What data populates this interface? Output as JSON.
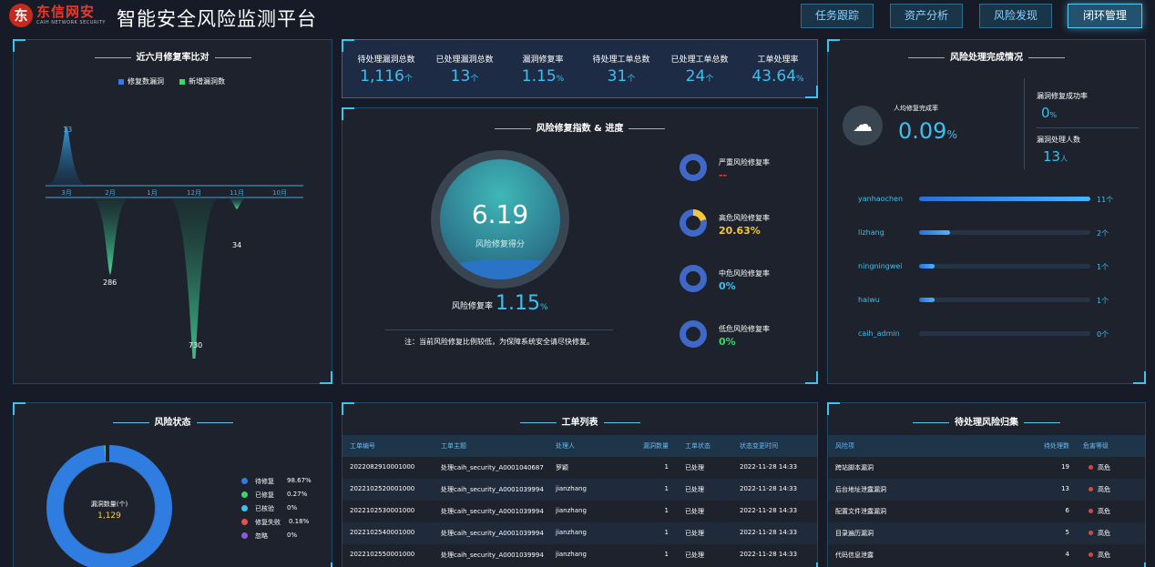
{
  "brand": {
    "logo_char": "东",
    "name": "东信网安",
    "sub": "CAIH NETWORK SECURITY"
  },
  "app_title": "智能安全风险监测平台",
  "nav": [
    "任务跟踪",
    "资产分析",
    "风险发现",
    "闭环管理"
  ],
  "nav_active": "闭环管理",
  "repair_compare": {
    "title": "近六月修复率比对",
    "legend": [
      "修复数漏洞",
      "新增漏洞数"
    ],
    "months": [
      "3月",
      "2月",
      "1月",
      "12月",
      "11月",
      "10月"
    ],
    "chart_data": {
      "type": "area",
      "categories": [
        "3月",
        "2月",
        "1月",
        "12月",
        "11月",
        "10月"
      ],
      "series": [
        {
          "name": "修复数漏洞",
          "values": [
            13,
            0,
            0,
            0,
            0,
            0
          ]
        },
        {
          "name": "新增漏洞数",
          "values": [
            0,
            286,
            0,
            730,
            34,
            0
          ]
        }
      ]
    },
    "labels": {
      "up": "13",
      "down1": "286",
      "down2": "730",
      "down3": "34"
    }
  },
  "stats": [
    {
      "label": "待处理漏洞总数",
      "value": "1,116",
      "unit": "个"
    },
    {
      "label": "已处理漏洞总数",
      "value": "13",
      "unit": "个"
    },
    {
      "label": "漏洞修复率",
      "value": "1.15",
      "unit": "%"
    },
    {
      "label": "待处理工单总数",
      "value": "31",
      "unit": "个"
    },
    {
      "label": "已处理工单总数",
      "value": "24",
      "unit": "个"
    },
    {
      "label": "工单处理率",
      "value": "43.64",
      "unit": "%"
    }
  ],
  "risk_index": {
    "title": "风险修复指数 & 进度",
    "score": "6.19",
    "score_label": "风险修复得分",
    "rate_label": "风险修复率",
    "rate_value": "1.15",
    "rate_unit": "%",
    "note": "注：当前风险修复比例较低，为保障系统安全请尽快修复。",
    "levels": [
      {
        "label": "严重风险修复率",
        "value": "--",
        "color": "#e8413a",
        "fraction": 0
      },
      {
        "label": "高危风险修复率",
        "value": "20.63%",
        "color": "#f4c83a",
        "fraction": 0.2063
      },
      {
        "label": "中危风险修复率",
        "value": "0%",
        "color": "#3cc0f0",
        "fraction": 0
      },
      {
        "label": "低危风险修复率",
        "value": "0%",
        "color": "#3ad86a",
        "fraction": 0
      }
    ]
  },
  "completion": {
    "title": "风险处理完成情况",
    "avg_label": "人均修复完成率",
    "avg_value": "0.09",
    "avg_unit": "%",
    "success_label": "漏洞修复成功率",
    "success_value": "0",
    "success_unit": "%",
    "handlers_label": "漏洞处理人数",
    "handlers_value": "13",
    "handlers_unit": "人",
    "people": [
      {
        "name": "yanhaochen",
        "count": "11个",
        "fraction": 1.0
      },
      {
        "name": "lizhang",
        "count": "2个",
        "fraction": 0.18
      },
      {
        "name": "ningningwei",
        "count": "1个",
        "fraction": 0.09
      },
      {
        "name": "haiwu",
        "count": "1个",
        "fraction": 0.09
      },
      {
        "name": "caih_admin",
        "count": "0个",
        "fraction": 0
      }
    ]
  },
  "risk_state": {
    "title": "风险状态",
    "center_label": "漏洞数量(个)",
    "center_value": "1,129",
    "items": [
      {
        "label": "待修复",
        "value": "98.67%",
        "color": "#2f7de0"
      },
      {
        "label": "已修复",
        "value": "0.27%",
        "color": "#3ad86a"
      },
      {
        "label": "已核验",
        "value": "0%",
        "color": "#3cc0f0"
      },
      {
        "label": "修复失败",
        "value": "0.18%",
        "color": "#e8504a"
      },
      {
        "label": "忽略",
        "value": "0%",
        "color": "#8a5ae0"
      }
    ]
  },
  "workorders": {
    "title": "工单列表",
    "columns": [
      "工单编号",
      "工单主题",
      "处理人",
      "漏洞数量",
      "工单状态",
      "状态变更时间"
    ],
    "rows": [
      [
        "2022082910001000",
        "处理caih_security_A0001040687",
        "罗颖",
        "1",
        "已处理",
        "2022-11-28 14:33"
      ],
      [
        "2022102520001000",
        "处理caih_security_A0001039994",
        "jianzhang",
        "1",
        "已处理",
        "2022-11-28 14:33"
      ],
      [
        "2022102530001000",
        "处理caih_security_A0001039994",
        "jianzhang",
        "1",
        "已处理",
        "2022-11-28 14:33"
      ],
      [
        "2022102540001000",
        "处理caih_security_A0001039994",
        "jianzhang",
        "1",
        "已处理",
        "2022-11-28 14:33"
      ],
      [
        "2022102550001000",
        "处理caih_security_A0001039994",
        "jianzhang",
        "1",
        "已处理",
        "2022-11-28 14:33"
      ]
    ]
  },
  "pending": {
    "title": "待处理风险归集",
    "columns": [
      "风险项",
      "待处理数",
      "危害等级"
    ],
    "rows": [
      [
        "跨站脚本漏洞",
        "19",
        "高危"
      ],
      [
        "后台地址泄露漏洞",
        "13",
        "高危"
      ],
      [
        "配置文件泄露漏洞",
        "6",
        "高危"
      ],
      [
        "目录遍历漏洞",
        "5",
        "高危"
      ],
      [
        "代码信息泄露",
        "4",
        "高危"
      ]
    ]
  }
}
